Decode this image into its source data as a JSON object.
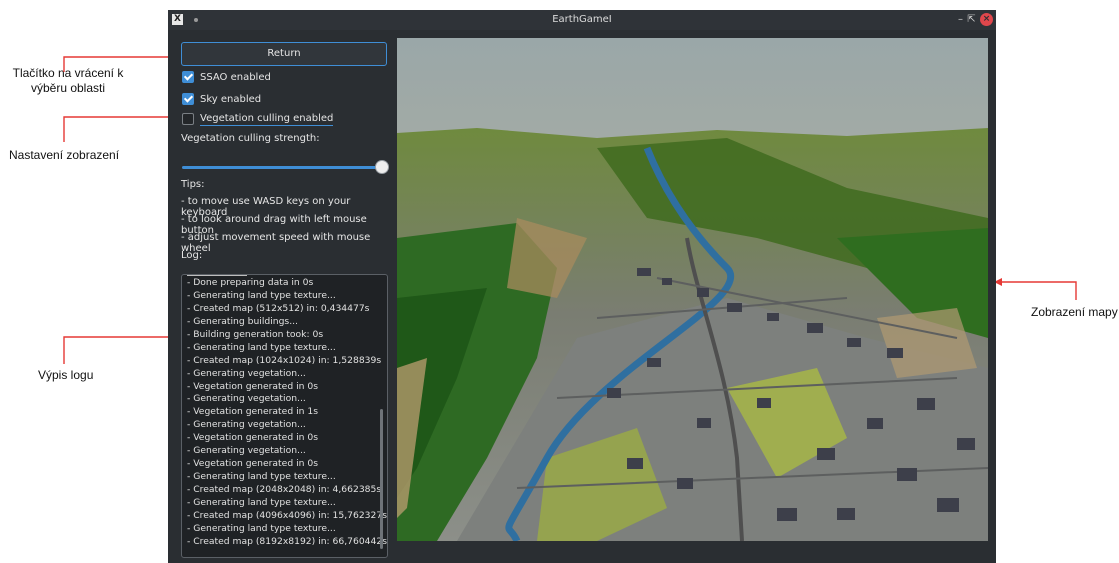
{
  "annotations": {
    "return_button": "Tlačítko na vrácení k výběru oblasti",
    "display_settings": "Nastavení zobrazení",
    "log_listing": "Výpis logu",
    "map_display": "Zobrazení mapy"
  },
  "window": {
    "title": "EarthGameI",
    "app_icon": "X",
    "controls": [
      "minimize-icon",
      "maximize-icon",
      "close-icon"
    ]
  },
  "panel": {
    "return_label": "Return",
    "ssao": {
      "label": "SSAO enabled",
      "checked": true
    },
    "sky": {
      "label": "Sky enabled",
      "checked": true
    },
    "vegetation_culling": {
      "label": "Vegetation culling enabled",
      "checked": false
    },
    "culling_strength_label": "Vegetation culling strength:",
    "culling_strength_value": 1.0,
    "tips_label": "Tips:",
    "tips": [
      "- to move use WASD keys on your keyboard",
      "- to look around drag with left mouse button",
      "- adjust movement speed with mouse wheel"
    ],
    "log_label": "Log:",
    "log": [
      "- Done preparing data in 0s",
      "- Generating land type texture...",
      "- Created map (512x512) in: 0,434477s",
      "- Generating buildings...",
      "- Building generation took: 0s",
      "- Generating land type texture...",
      "- Created map (1024x1024) in: 1,528839s",
      "- Generating vegetation...",
      "- Vegetation generated in 0s",
      "- Generating vegetation...",
      "- Vegetation generated in 1s",
      "- Generating vegetation...",
      "- Vegetation generated in 0s",
      "- Generating vegetation...",
      "- Vegetation generated in 0s",
      "- Generating land type texture...",
      "- Created map (2048x2048) in: 4,662385s",
      "- Generating land type texture...",
      "- Created map (4096x4096) in: 15,762327s",
      "- Generating land type texture...",
      "- Created map (8192x8192) in: 66,760442s"
    ]
  },
  "colors": {
    "accent": "#3f8ed6",
    "window_bg": "#2a2e32",
    "annotation_arrow": "#e53935",
    "close_button": "#e0474c"
  }
}
